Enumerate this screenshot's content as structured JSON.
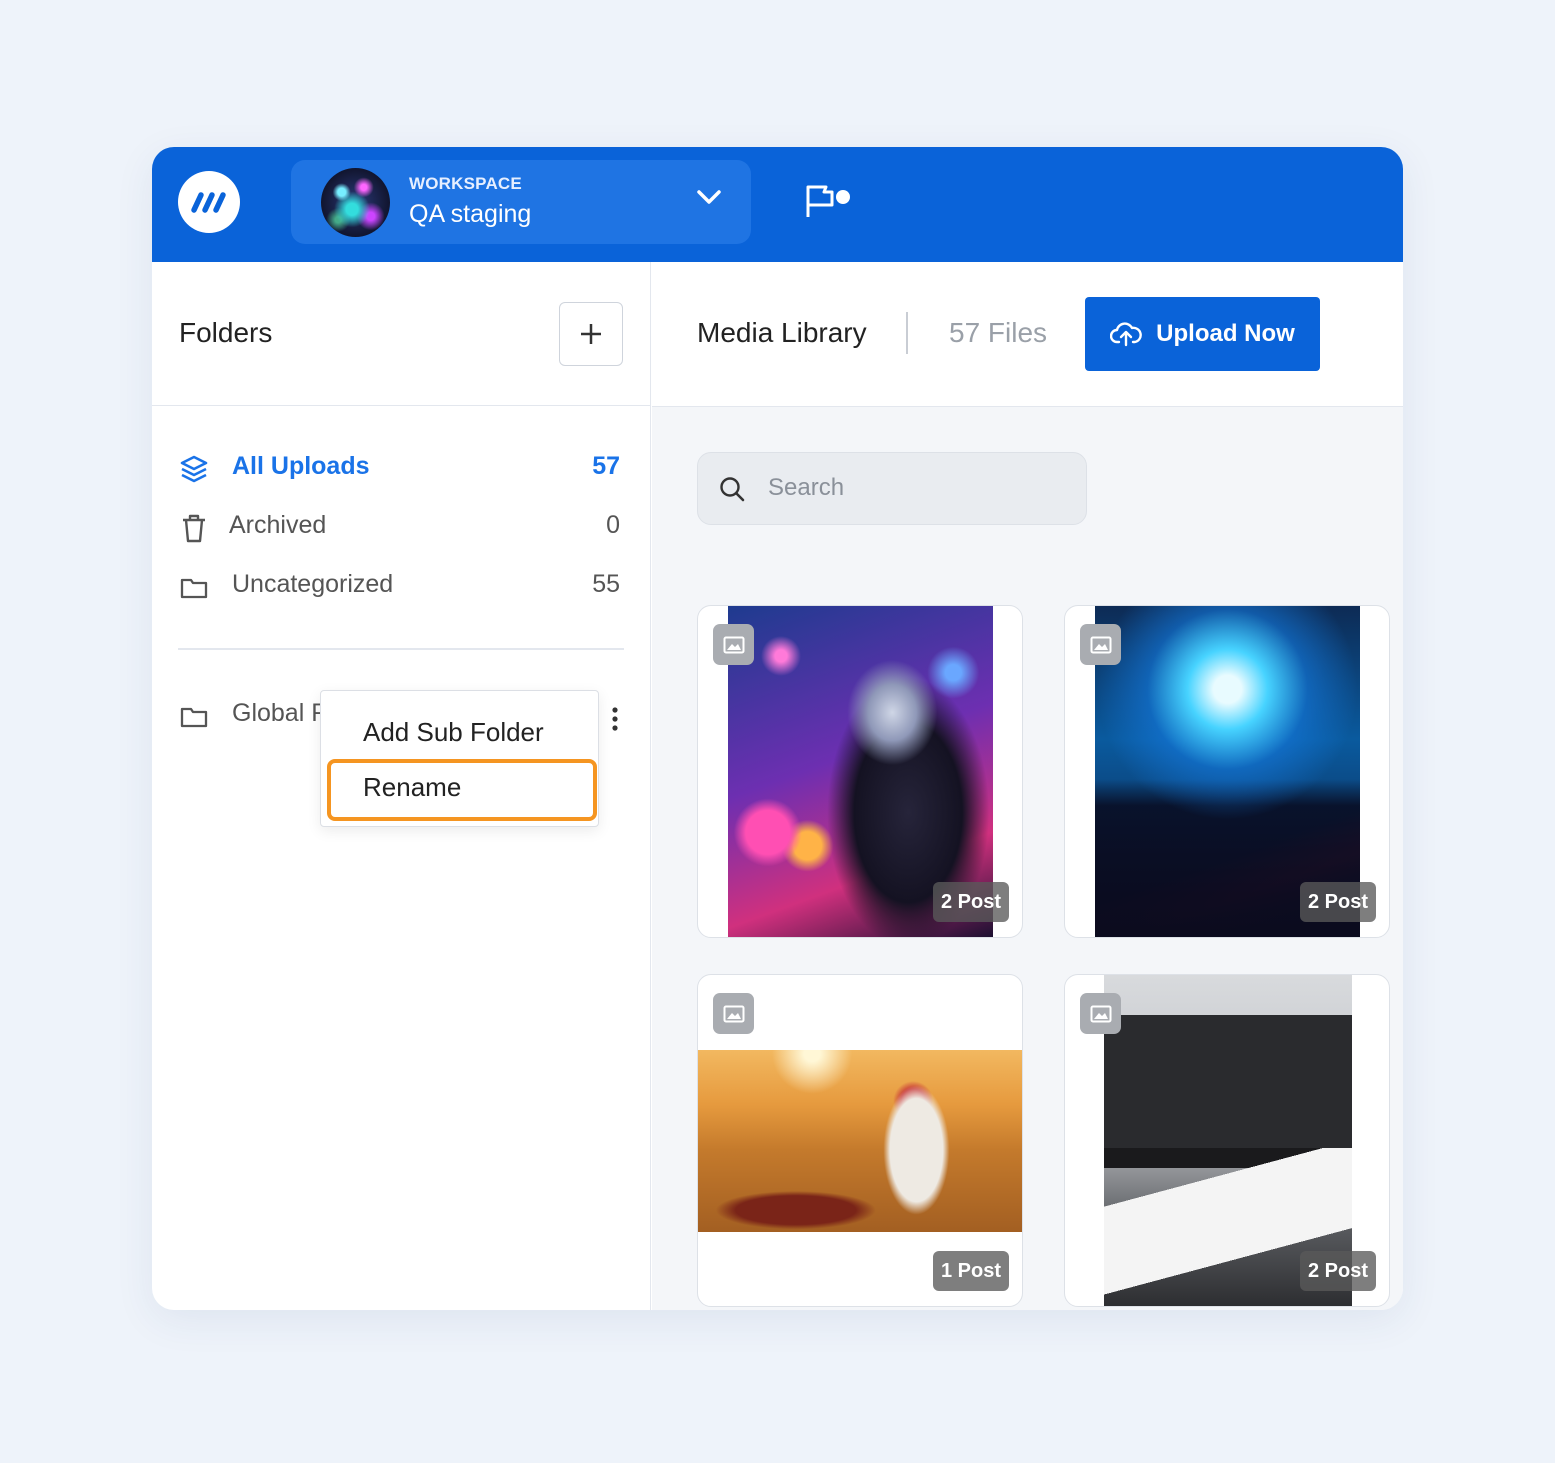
{
  "header": {
    "workspace_label": "WORKSPACE",
    "workspace_name": "QA staging"
  },
  "folders": {
    "title": "Folders",
    "items": [
      {
        "label": "All Uploads",
        "count": "57",
        "icon": "layers-icon",
        "active": true
      },
      {
        "label": "Archived",
        "count": "0",
        "icon": "trash-icon"
      },
      {
        "label": "Uncategorized",
        "count": "55",
        "icon": "folder-icon"
      }
    ],
    "custom": [
      {
        "label": "Global F",
        "icon": "folder-icon"
      }
    ]
  },
  "context_menu": {
    "items": [
      "Add Sub Folder",
      "Rename"
    ],
    "highlighted": "Rename"
  },
  "media": {
    "title": "Media Library",
    "files": "57 Files",
    "upload_label": "Upload Now",
    "search_placeholder": "Search",
    "cards": [
      {
        "posts": "2 Post",
        "type_icon": "image-icon"
      },
      {
        "posts": "2 Post",
        "type_icon": "image-icon"
      },
      {
        "posts": "1 Post",
        "type_icon": "image-icon"
      },
      {
        "posts": "2 Post",
        "type_icon": "image-icon"
      }
    ]
  },
  "colors": {
    "brand": "#0a63d9",
    "accent_text": "#1a73e8",
    "highlight": "#f59521"
  }
}
